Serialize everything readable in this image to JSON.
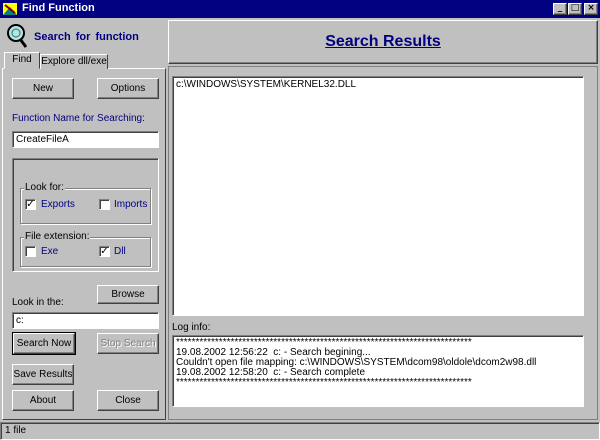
{
  "window": {
    "title": "Find Function"
  },
  "header": {
    "search_for_function": "Search  for  function",
    "results_title": "Search Results"
  },
  "tabs": [
    {
      "label": "Find"
    },
    {
      "label": "Explore dll/exe"
    }
  ],
  "find": {
    "new_label": "New",
    "options_label": "Options",
    "function_name_label": "Function Name for Searching:",
    "function_name_value": "CreateFileA",
    "look_for": {
      "title": "Look for:",
      "exports_label": "Exports",
      "exports_checked": true,
      "imports_label": "Imports",
      "imports_checked": false
    },
    "file_ext": {
      "title": "File extension:",
      "exe_label": "Exe",
      "exe_checked": false,
      "dll_label": "Dll",
      "dll_checked": true
    },
    "browse_label": "Browse",
    "look_in_label": "Look in the:",
    "look_in_value": "c:",
    "search_now_label": "Search Now",
    "stop_search_label": "Stop Search",
    "save_results_label": "Save Results",
    "about_label": "About",
    "close_label": "Close"
  },
  "results": {
    "items": [
      "c:\\WINDOWS\\SYSTEM\\KERNEL32.DLL"
    ]
  },
  "log": {
    "label": "Log info:",
    "lines": [
      "****************************************************************************",
      "19.08.2002 12:56:22  c: - Search begining...",
      "Couldn't open file mapping: c:\\WINDOWS\\SYSTEM\\dcom98\\oldole\\dcom2w98.dll",
      "19.08.2002 12:58:20  c: - Search complete",
      "****************************************************************************"
    ]
  },
  "status": {
    "text": "1 file"
  },
  "colors": {
    "titlebar": "#000080",
    "accent_text": "#000080"
  }
}
